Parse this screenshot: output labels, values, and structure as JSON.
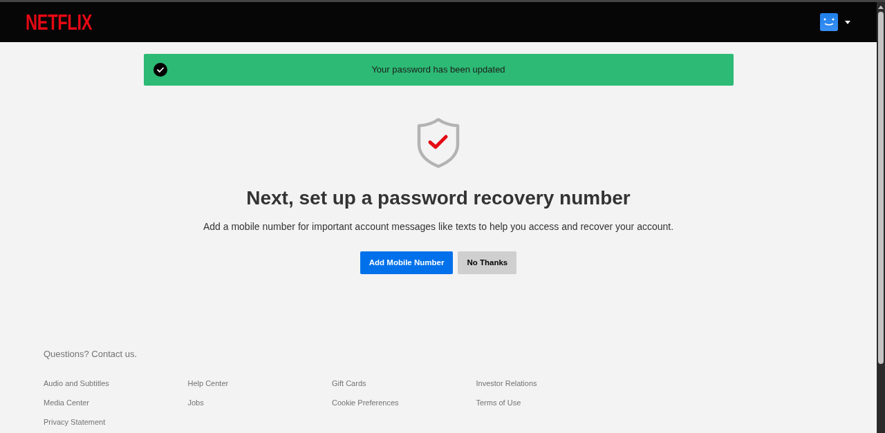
{
  "header": {
    "logo": "NETFLIX"
  },
  "alert": {
    "message": "Your password has been updated"
  },
  "prompt": {
    "title": "Next, set up a password recovery number",
    "description": "Add a mobile number for important account messages like texts to help you access and recover your account.",
    "buttons": [
      {
        "label": "Add Mobile Number",
        "kind": "primary"
      },
      {
        "label": "No Thanks",
        "kind": "secondary"
      }
    ]
  },
  "footer": {
    "contact": "Questions? Contact us.",
    "links": [
      "Audio and Subtitles",
      "Help Center",
      "Gift Cards",
      "Investor Relations",
      "Media Center",
      "Jobs",
      "Cookie Preferences",
      "Terms of Use",
      "Privacy Statement"
    ]
  }
}
